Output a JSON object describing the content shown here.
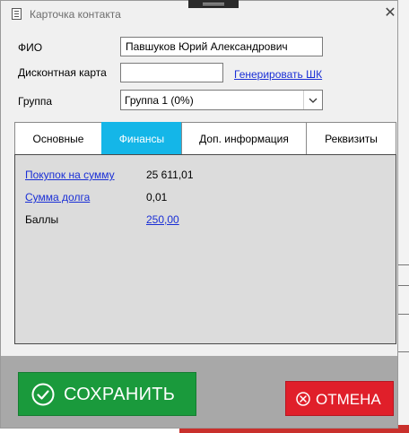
{
  "window": {
    "title": "Карточка контакта",
    "close_glyph": "✕"
  },
  "form": {
    "fio_label": "ФИО",
    "fio_value": "Павшуков Юрий Александрович",
    "card_label": "Дисконтная карта",
    "card_value": "",
    "generate_link": "Генерировать ШК",
    "group_label": "Группа",
    "group_value": "Группа 1 (0%)"
  },
  "tabs": [
    {
      "label": "Основные",
      "active": false
    },
    {
      "label": "Финансы",
      "active": true
    },
    {
      "label": "Доп. информация",
      "active": false
    },
    {
      "label": "Реквизиты",
      "active": false
    }
  ],
  "finance": {
    "purchases_label": "Покупок на сумму",
    "purchases_value": "25 611,01",
    "debt_label": "Сумма долга",
    "debt_value": "0,01",
    "points_label": "Баллы",
    "points_value": "250,00"
  },
  "buttons": {
    "save_label": "СОХРАНИТЬ",
    "cancel_label": "ОТМЕНА"
  },
  "colors": {
    "active_tab": "#14b6e8",
    "save": "#1a9a3c",
    "cancel": "#e01f2a",
    "link": "#1a2fd6"
  }
}
